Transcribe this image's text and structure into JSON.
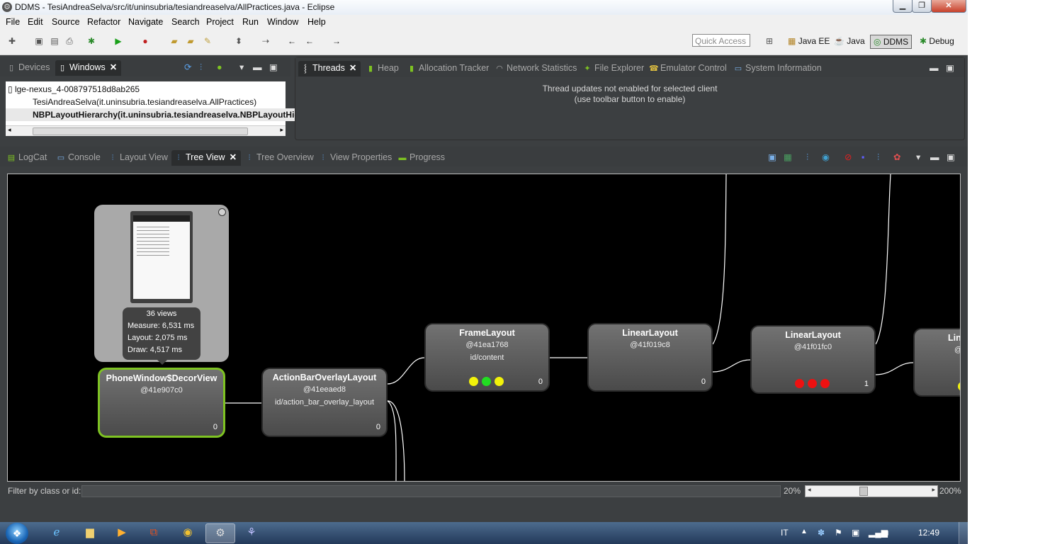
{
  "window": {
    "title": "DDMS - TesiAndreaSelva/src/it/uninsubria/tesiandreaselva/AllPractices.java - Eclipse",
    "controls": {
      "minimize": "▁",
      "maximize": "❐",
      "close": "✕"
    }
  },
  "menu": [
    "File",
    "Edit",
    "Source",
    "Refactor",
    "Navigate",
    "Search",
    "Project",
    "Run",
    "Window",
    "Help"
  ],
  "toolbar": {
    "quick_access_placeholder": "Quick Access",
    "perspectives": [
      {
        "label": "Java EE",
        "active": false
      },
      {
        "label": "Java",
        "active": false
      },
      {
        "label": "DDMS",
        "active": true
      },
      {
        "label": "Debug",
        "active": false
      }
    ]
  },
  "devices_view": {
    "tabs": [
      {
        "label": "Devices",
        "active": false
      },
      {
        "label": "Windows",
        "active": true
      }
    ],
    "device": "lge-nexus_4-008797518d8ab265",
    "windows": [
      {
        "label": "TesiAndreaSelva(it.uninsubria.tesiandreaselva.AllPractices)",
        "selected": false
      },
      {
        "label": "NBPLayoutHierarchy(it.uninsubria.tesiandreaselva.NBPLayoutHie",
        "selected": true
      }
    ]
  },
  "threads_view": {
    "tabs": [
      {
        "label": "Threads",
        "active": true
      },
      {
        "label": "Heap",
        "active": false
      },
      {
        "label": "Allocation Tracker",
        "active": false
      },
      {
        "label": "Network Statistics",
        "active": false
      },
      {
        "label": "File Explorer",
        "active": false
      },
      {
        "label": "Emulator Control",
        "active": false
      },
      {
        "label": "System Information",
        "active": false
      }
    ],
    "message_line1": "Thread updates not enabled for selected client",
    "message_line2": "(use toolbar button to enable)"
  },
  "hierarchy_view": {
    "tabs": [
      {
        "label": "LogCat",
        "active": false
      },
      {
        "label": "Console",
        "active": false
      },
      {
        "label": "Layout View",
        "active": false
      },
      {
        "label": "Tree View",
        "active": true
      },
      {
        "label": "Tree Overview",
        "active": false
      },
      {
        "label": "View Properties",
        "active": false
      },
      {
        "label": "Progress",
        "active": false
      }
    ],
    "preview": {
      "views": "36 views",
      "measure": "Measure: 6,531 ms",
      "layout": "Layout: 2,075 ms",
      "draw": "Draw: 4,517 ms"
    },
    "nodes": [
      {
        "name": "PhoneWindow$DecorView",
        "hash": "@41e907c0",
        "id": "",
        "index": "0",
        "selected": true
      },
      {
        "name": "ActionBarOverlayLayout",
        "hash": "@41eeaed8",
        "id": "id/action_bar_overlay_layout",
        "index": "0"
      },
      {
        "name": "FrameLayout",
        "hash": "@41ea1768",
        "id": "id/content",
        "index": "0",
        "lights": [
          "#f2f20a",
          "#22dd22",
          "#f2f20a"
        ]
      },
      {
        "name": "LinearLayout",
        "hash": "@41f019c8",
        "id": "",
        "index": "0"
      },
      {
        "name": "LinearLayout",
        "hash": "@41f01fc0",
        "id": "",
        "index": "1",
        "lights": [
          "#ee1111",
          "#ee1111",
          "#ee1111"
        ]
      },
      {
        "name": "Lin",
        "hash": "@",
        "id": "",
        "index": ""
      }
    ],
    "filter_label": "Filter by class or id:",
    "zoom_min": "20%",
    "zoom_max": "200%"
  },
  "taskbar": {
    "language": "IT",
    "time": "12:49",
    "apps": [
      "internet-explorer",
      "explorer",
      "media-player",
      "app",
      "chrome",
      "eclipse",
      "hierarchy-viewer"
    ]
  }
}
